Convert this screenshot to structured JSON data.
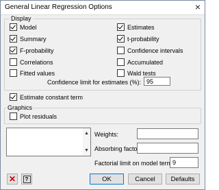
{
  "window": {
    "title": "General Linear Regression Options"
  },
  "display": {
    "label": "Display",
    "options": [
      {
        "label": "Model",
        "checked": true
      },
      {
        "label": "Summary",
        "checked": true
      },
      {
        "label": "F-probability",
        "checked": true
      },
      {
        "label": "Correlations",
        "checked": false
      },
      {
        "label": "Fitted values",
        "checked": false
      },
      {
        "label": "Estimates",
        "checked": true
      },
      {
        "label": "t-probability",
        "checked": true
      },
      {
        "label": "Confidence intervals",
        "checked": false
      },
      {
        "label": "Accumulated",
        "checked": false
      },
      {
        "label": "Wald tests",
        "checked": false
      }
    ],
    "confidence_label": "Confidence limit for estimates (%):",
    "confidence_value": "95"
  },
  "estimate_constant": {
    "label": "Estimate constant term",
    "checked": true
  },
  "graphics": {
    "label": "Graphics",
    "plot_residuals": {
      "label": "Plot residuals",
      "checked": false
    }
  },
  "fields": {
    "weights_label": "Weights:",
    "weights_value": "",
    "absorbing_label": "Absorbing factor:",
    "absorbing_value": "",
    "factorial_label": "Factorial limit on model terms:",
    "factorial_value": "9"
  },
  "buttons": {
    "ok": "OK",
    "cancel": "Cancel",
    "defaults": "Defaults"
  },
  "colors": {
    "accent": "#0078d7",
    "clear_icon": "#cc0000"
  }
}
